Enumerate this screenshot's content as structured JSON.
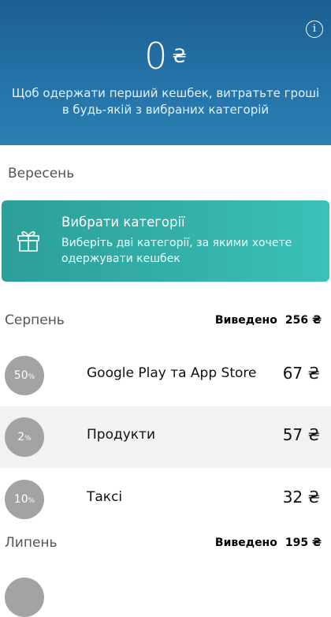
{
  "hero": {
    "amount": "0",
    "currency": "₴",
    "message": "Щоб одержати перший кешбек, витратьте гроші в будь-якій з вибраних категорій",
    "info_label": "i"
  },
  "current_month": {
    "name": "Вересень",
    "choose_card": {
      "title": "Вибрати категорії",
      "subtitle": "Виберіть дві категорії, за якими хочете одержувати кешбек",
      "icon": "gift-icon"
    }
  },
  "months": [
    {
      "name": "Серпень",
      "withdrawn_label": "Виведено",
      "withdrawn_amount": "256 ₴",
      "items": [
        {
          "percent": "50",
          "percent_sign": "%",
          "name": "Google Play та App Store",
          "amount": "67 ₴"
        },
        {
          "percent": "2",
          "percent_sign": "%",
          "name": "Продукти",
          "amount": "57 ₴"
        },
        {
          "percent": "10",
          "percent_sign": "%",
          "name": "Таксі",
          "amount": "32 ₴"
        }
      ]
    },
    {
      "name": "Липень",
      "withdrawn_label": "Виведено",
      "withdrawn_amount": "195 ₴",
      "items": []
    }
  ],
  "colors": {
    "hero_top": "#1c5f92",
    "card_accent": "#35b2aa",
    "percent_badge": "#a3a3a3"
  }
}
